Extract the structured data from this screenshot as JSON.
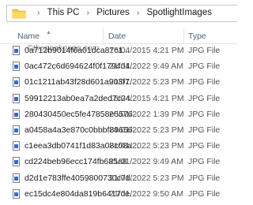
{
  "address": {
    "crumbs": [
      "This PC",
      "Pictures",
      "SpotlightImages"
    ],
    "separator": "›"
  },
  "columns": {
    "name": "Name",
    "date": "Date",
    "type": "Type"
  },
  "watermark": "©thegeekpage.com",
  "files": [
    {
      "name": "0a712b9014f6a01dca87c1...",
      "date": "16/04/2015 4:21 PM",
      "type": "JPG File"
    },
    {
      "name": "0ac472c6d694624f0f1794d4...",
      "date": "21/01/2022 9:49 AM",
      "type": "JPG File"
    },
    {
      "name": "01c1211ab43f28d601a903f7...",
      "date": "21/01/2022 5:23 PM",
      "type": "JPG File"
    },
    {
      "name": "59912213ab0ea7a2ded7c24...",
      "date": "16/04/2015 4:21 PM",
      "type": "JPG File"
    },
    {
      "name": "280430450ec5fe47858e5576...",
      "date": "20/01/2022 1:39 PM",
      "type": "JPG File"
    },
    {
      "name": "a0458a4a3e870c0bbbf89656...",
      "date": "24/01/2022 5:23 PM",
      "type": "JPG File"
    },
    {
      "name": "c1eea3db0741f1d83a08c08a...",
      "date": "21/01/2022 5:23 PM",
      "type": "JPG File"
    },
    {
      "name": "cd224beb96ecc174fb685a8...",
      "date": "21/01/2022 9:49 AM",
      "type": "JPG File"
    },
    {
      "name": "d2d1e783ffe4059800730c7d...",
      "date": "21/01/2022 5:23 PM",
      "type": "JPG File"
    },
    {
      "name": "ec15dc4e804da819b6417de...",
      "date": "21/01/2022 9:50 AM",
      "type": "JPG File"
    }
  ]
}
